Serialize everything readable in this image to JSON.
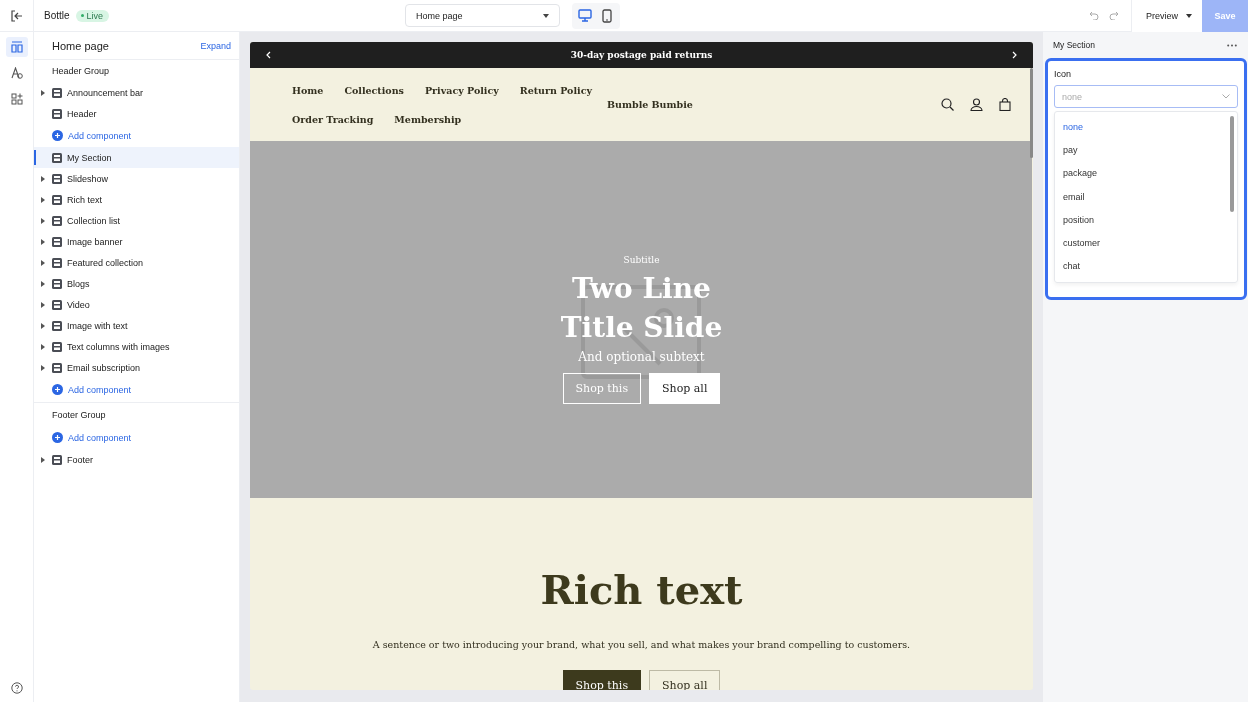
{
  "topbar": {
    "store_name": "Bottle",
    "status_badge": "Live",
    "page_select": "Home page",
    "devices": [
      {
        "kind": "desktop",
        "selected": true
      },
      {
        "kind": "mobile",
        "selected": false
      }
    ],
    "preview": "Preview",
    "save": {
      "label": "Save",
      "disabled": true
    }
  },
  "sidebar": {
    "title": "Home page",
    "expand": "Expand",
    "items": [
      {
        "kind": "group",
        "label": "Header Group"
      },
      {
        "kind": "item",
        "label": "Announcement bar",
        "expandable": true,
        "selected": false
      },
      {
        "kind": "item",
        "label": "Header",
        "expandable": false,
        "selected": false
      },
      {
        "kind": "add",
        "label": "Add component"
      },
      {
        "kind": "item",
        "label": "My Section",
        "expandable": false,
        "selected": true
      },
      {
        "kind": "item",
        "label": "Slideshow",
        "expandable": true,
        "selected": false
      },
      {
        "kind": "item",
        "label": "Rich text",
        "expandable": true,
        "selected": false
      },
      {
        "kind": "item",
        "label": "Collection list",
        "expandable": true,
        "selected": false
      },
      {
        "kind": "item",
        "label": "Image banner",
        "expandable": true,
        "selected": false
      },
      {
        "kind": "item",
        "label": "Featured collection",
        "expandable": true,
        "selected": false
      },
      {
        "kind": "item",
        "label": "Blogs",
        "expandable": true,
        "selected": false
      },
      {
        "kind": "item",
        "label": "Video",
        "expandable": true,
        "selected": false
      },
      {
        "kind": "item",
        "label": "Image with text",
        "expandable": true,
        "selected": false
      },
      {
        "kind": "item",
        "label": "Text columns with images",
        "expandable": true,
        "selected": false
      },
      {
        "kind": "item",
        "label": "Email subscription",
        "expandable": true,
        "selected": false
      },
      {
        "kind": "add",
        "label": "Add component"
      },
      {
        "kind": "divider"
      },
      {
        "kind": "group",
        "label": "Footer Group"
      },
      {
        "kind": "add",
        "label": "Add component"
      },
      {
        "kind": "item",
        "label": "Footer",
        "expandable": true,
        "selected": false
      }
    ]
  },
  "preview": {
    "announcement": "30-day postage paid returns",
    "nav": [
      "Home",
      "Collections",
      "Privacy Policy",
      "Return Policy",
      "Order Tracking",
      "Membership"
    ],
    "brand": "Bumble Bumbie",
    "hero": {
      "subtitle": "Subtitle",
      "title_lines": [
        "Two Line",
        "Title Slide"
      ],
      "subtext": "And optional subtext",
      "buttons": [
        {
          "label": "Shop this",
          "kind": "outline"
        },
        {
          "label": "Shop all",
          "kind": "solid"
        }
      ]
    },
    "rich_text": {
      "title": "Rich text",
      "body": "A sentence or two introducing your brand, what you sell, and what makes your brand compelling to customers.",
      "buttons": [
        {
          "label": "Shop this",
          "kind": "dark"
        },
        {
          "label": "Shop all",
          "kind": "outline"
        }
      ]
    }
  },
  "settings": {
    "title": "My Section",
    "field_label": "Icon",
    "placeholder": "none",
    "options": [
      {
        "label": "none",
        "selected": true
      },
      {
        "label": "pay",
        "selected": false
      },
      {
        "label": "package",
        "selected": false
      },
      {
        "label": "email",
        "selected": false
      },
      {
        "label": "position",
        "selected": false
      },
      {
        "label": "customer",
        "selected": false
      },
      {
        "label": "chat",
        "selected": false
      }
    ]
  }
}
